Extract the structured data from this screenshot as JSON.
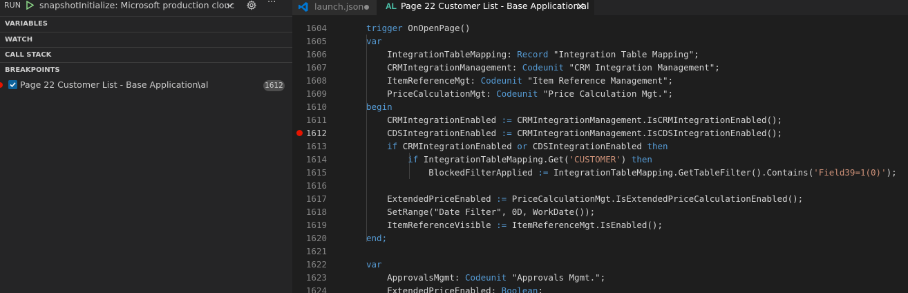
{
  "colors": {
    "sidebar_bg": "#252526",
    "editor_bg": "#1e1e1e",
    "breakpoint_red": "#e51400",
    "keyword_blue": "#569cd6",
    "string_orange": "#ce9178",
    "al_icon_teal": "#4ec9b0",
    "vscode_icon_blue": "#0078d4"
  },
  "run": {
    "label": "RUN",
    "play_icon": "play-icon",
    "config": "snapshotInitialize: Microsoft production clouc",
    "gear_icon": "gear-icon",
    "more": "···"
  },
  "sections": {
    "variables": "VARIABLES",
    "watch": "WATCH",
    "call_stack": "CALL STACK",
    "breakpoints": "BREAKPOINTS"
  },
  "breakpoint": {
    "checked": true,
    "label": "Page 22 Customer List - Base Application.al",
    "path": "\\",
    "line": "1612"
  },
  "tabs": [
    {
      "label": "launch.json",
      "icon": "vscode-icon",
      "dirty": true,
      "active": false
    },
    {
      "icon_text": "AL",
      "label": "Page 22 Customer List - Base Application.al",
      "active": true,
      "close_icon": "close-icon"
    }
  ],
  "editor": {
    "breakpoint_line": "1612",
    "lines": [
      {
        "n": "1604",
        "tokens": [
          {
            "t": "trigger ",
            "c": "kw"
          },
          {
            "t": "OnOpenPage()",
            "c": "id"
          }
        ]
      },
      {
        "n": "1605",
        "tokens": [
          {
            "t": "var",
            "c": "kw"
          }
        ]
      },
      {
        "n": "1606",
        "tokens": [
          {
            "t": "    IntegrationTableMapping: ",
            "c": "id"
          },
          {
            "t": "Record",
            "c": "kw"
          },
          {
            "t": " \"Integration Table Mapping\";",
            "c": "id"
          }
        ]
      },
      {
        "n": "1607",
        "tokens": [
          {
            "t": "    CRMIntegrationManagement: ",
            "c": "id"
          },
          {
            "t": "Codeunit",
            "c": "kw"
          },
          {
            "t": " \"CRM Integration Management\";",
            "c": "id"
          }
        ]
      },
      {
        "n": "1608",
        "tokens": [
          {
            "t": "    ItemReferenceMgt: ",
            "c": "id"
          },
          {
            "t": "Codeunit",
            "c": "kw"
          },
          {
            "t": " \"Item Reference Management\";",
            "c": "id"
          }
        ]
      },
      {
        "n": "1609",
        "tokens": [
          {
            "t": "    PriceCalculationMgt: ",
            "c": "id"
          },
          {
            "t": "Codeunit",
            "c": "kw"
          },
          {
            "t": " \"Price Calculation Mgt.\";",
            "c": "id"
          }
        ]
      },
      {
        "n": "1610",
        "tokens": [
          {
            "t": "begin",
            "c": "kw"
          }
        ]
      },
      {
        "n": "1611",
        "tokens": [
          {
            "t": "    CRMIntegrationEnabled ",
            "c": "id"
          },
          {
            "t": ":=",
            "c": "op"
          },
          {
            "t": " CRMIntegrationManagement.IsCRMIntegrationEnabled();",
            "c": "id"
          }
        ]
      },
      {
        "n": "1612",
        "tokens": [
          {
            "t": "    CDSIntegrationEnabled ",
            "c": "id"
          },
          {
            "t": ":=",
            "c": "op"
          },
          {
            "t": " CRMIntegrationManagement.IsCDSIntegrationEnabled();",
            "c": "id"
          }
        ]
      },
      {
        "n": "1613",
        "tokens": [
          {
            "t": "    ",
            "c": "id"
          },
          {
            "t": "if",
            "c": "kw"
          },
          {
            "t": " CRMIntegrationEnabled ",
            "c": "id"
          },
          {
            "t": "or",
            "c": "kw"
          },
          {
            "t": " CDSIntegrationEnabled ",
            "c": "id"
          },
          {
            "t": "then",
            "c": "kw"
          }
        ]
      },
      {
        "n": "1614",
        "tokens": [
          {
            "t": "        ",
            "c": "id"
          },
          {
            "t": "if",
            "c": "kw"
          },
          {
            "t": " IntegrationTableMapping.Get(",
            "c": "id"
          },
          {
            "t": "'CUSTOMER'",
            "c": "str"
          },
          {
            "t": ") ",
            "c": "id"
          },
          {
            "t": "then",
            "c": "kw"
          }
        ]
      },
      {
        "n": "1615",
        "tokens": [
          {
            "t": "            BlockedFilterApplied ",
            "c": "id"
          },
          {
            "t": ":=",
            "c": "op"
          },
          {
            "t": " IntegrationTableMapping.GetTableFilter().Contains(",
            "c": "id"
          },
          {
            "t": "'Field39=1(0)'",
            "c": "str"
          },
          {
            "t": ");",
            "c": "id"
          }
        ]
      },
      {
        "n": "1616",
        "tokens": []
      },
      {
        "n": "1617",
        "tokens": [
          {
            "t": "    ExtendedPriceEnabled ",
            "c": "id"
          },
          {
            "t": ":=",
            "c": "op"
          },
          {
            "t": " PriceCalculationMgt.IsExtendedPriceCalculationEnabled();",
            "c": "id"
          }
        ]
      },
      {
        "n": "1618",
        "tokens": [
          {
            "t": "    SetRange(\"Date Filter\", 0D, WorkDate());",
            "c": "id"
          }
        ]
      },
      {
        "n": "1619",
        "tokens": [
          {
            "t": "    ItemReferenceVisible ",
            "c": "id"
          },
          {
            "t": ":=",
            "c": "op"
          },
          {
            "t": " ItemReferenceMgt.IsEnabled();",
            "c": "id"
          }
        ]
      },
      {
        "n": "1620",
        "tokens": [
          {
            "t": "end;",
            "c": "kw"
          }
        ]
      },
      {
        "n": "1621",
        "tokens": []
      },
      {
        "n": "1622",
        "tokens": [
          {
            "t": "var",
            "c": "kw"
          }
        ]
      },
      {
        "n": "1623",
        "tokens": [
          {
            "t": "    ApprovalsMgmt: ",
            "c": "id"
          },
          {
            "t": "Codeunit",
            "c": "kw"
          },
          {
            "t": " \"Approvals Mgmt.\";",
            "c": "id"
          }
        ]
      },
      {
        "n": "1624",
        "tokens": [
          {
            "t": "    ExtendedPriceEnabled: ",
            "c": "id"
          },
          {
            "t": "Boolean",
            "c": "kw"
          },
          {
            "t": ";",
            "c": "id"
          }
        ]
      }
    ]
  }
}
